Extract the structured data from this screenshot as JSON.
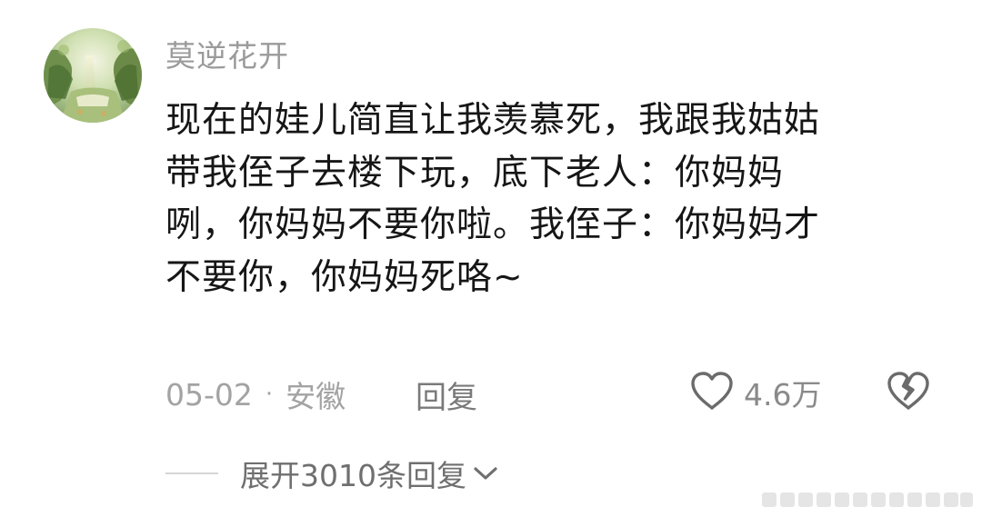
{
  "comment": {
    "username": "莫逆花开",
    "body_lines": [
      "现在的娃儿简直让我羡慕死，我跟我姑姑",
      "带我侄子去楼下玩，底下老人：你妈妈",
      "咧，你妈妈不要你啦。我侄子：你妈妈才",
      "不要你，你妈妈死咯~"
    ],
    "date": "05-02",
    "separator": "·",
    "location": "安徽",
    "reply_label": "回复",
    "like_count": "4.6万",
    "expand_label": "展开3010条回复"
  },
  "icons": {
    "like": "heart-outline-icon",
    "dislike": "broken-heart-icon",
    "expand": "chevron-down-icon"
  },
  "colors": {
    "username": "#9b9b9b",
    "body_text": "#161616",
    "meta_text": "#a3a3a3",
    "reply_text": "#7a7a7a",
    "expand_text": "#6f6f6f",
    "icon_stroke": "#6b6b6b"
  }
}
